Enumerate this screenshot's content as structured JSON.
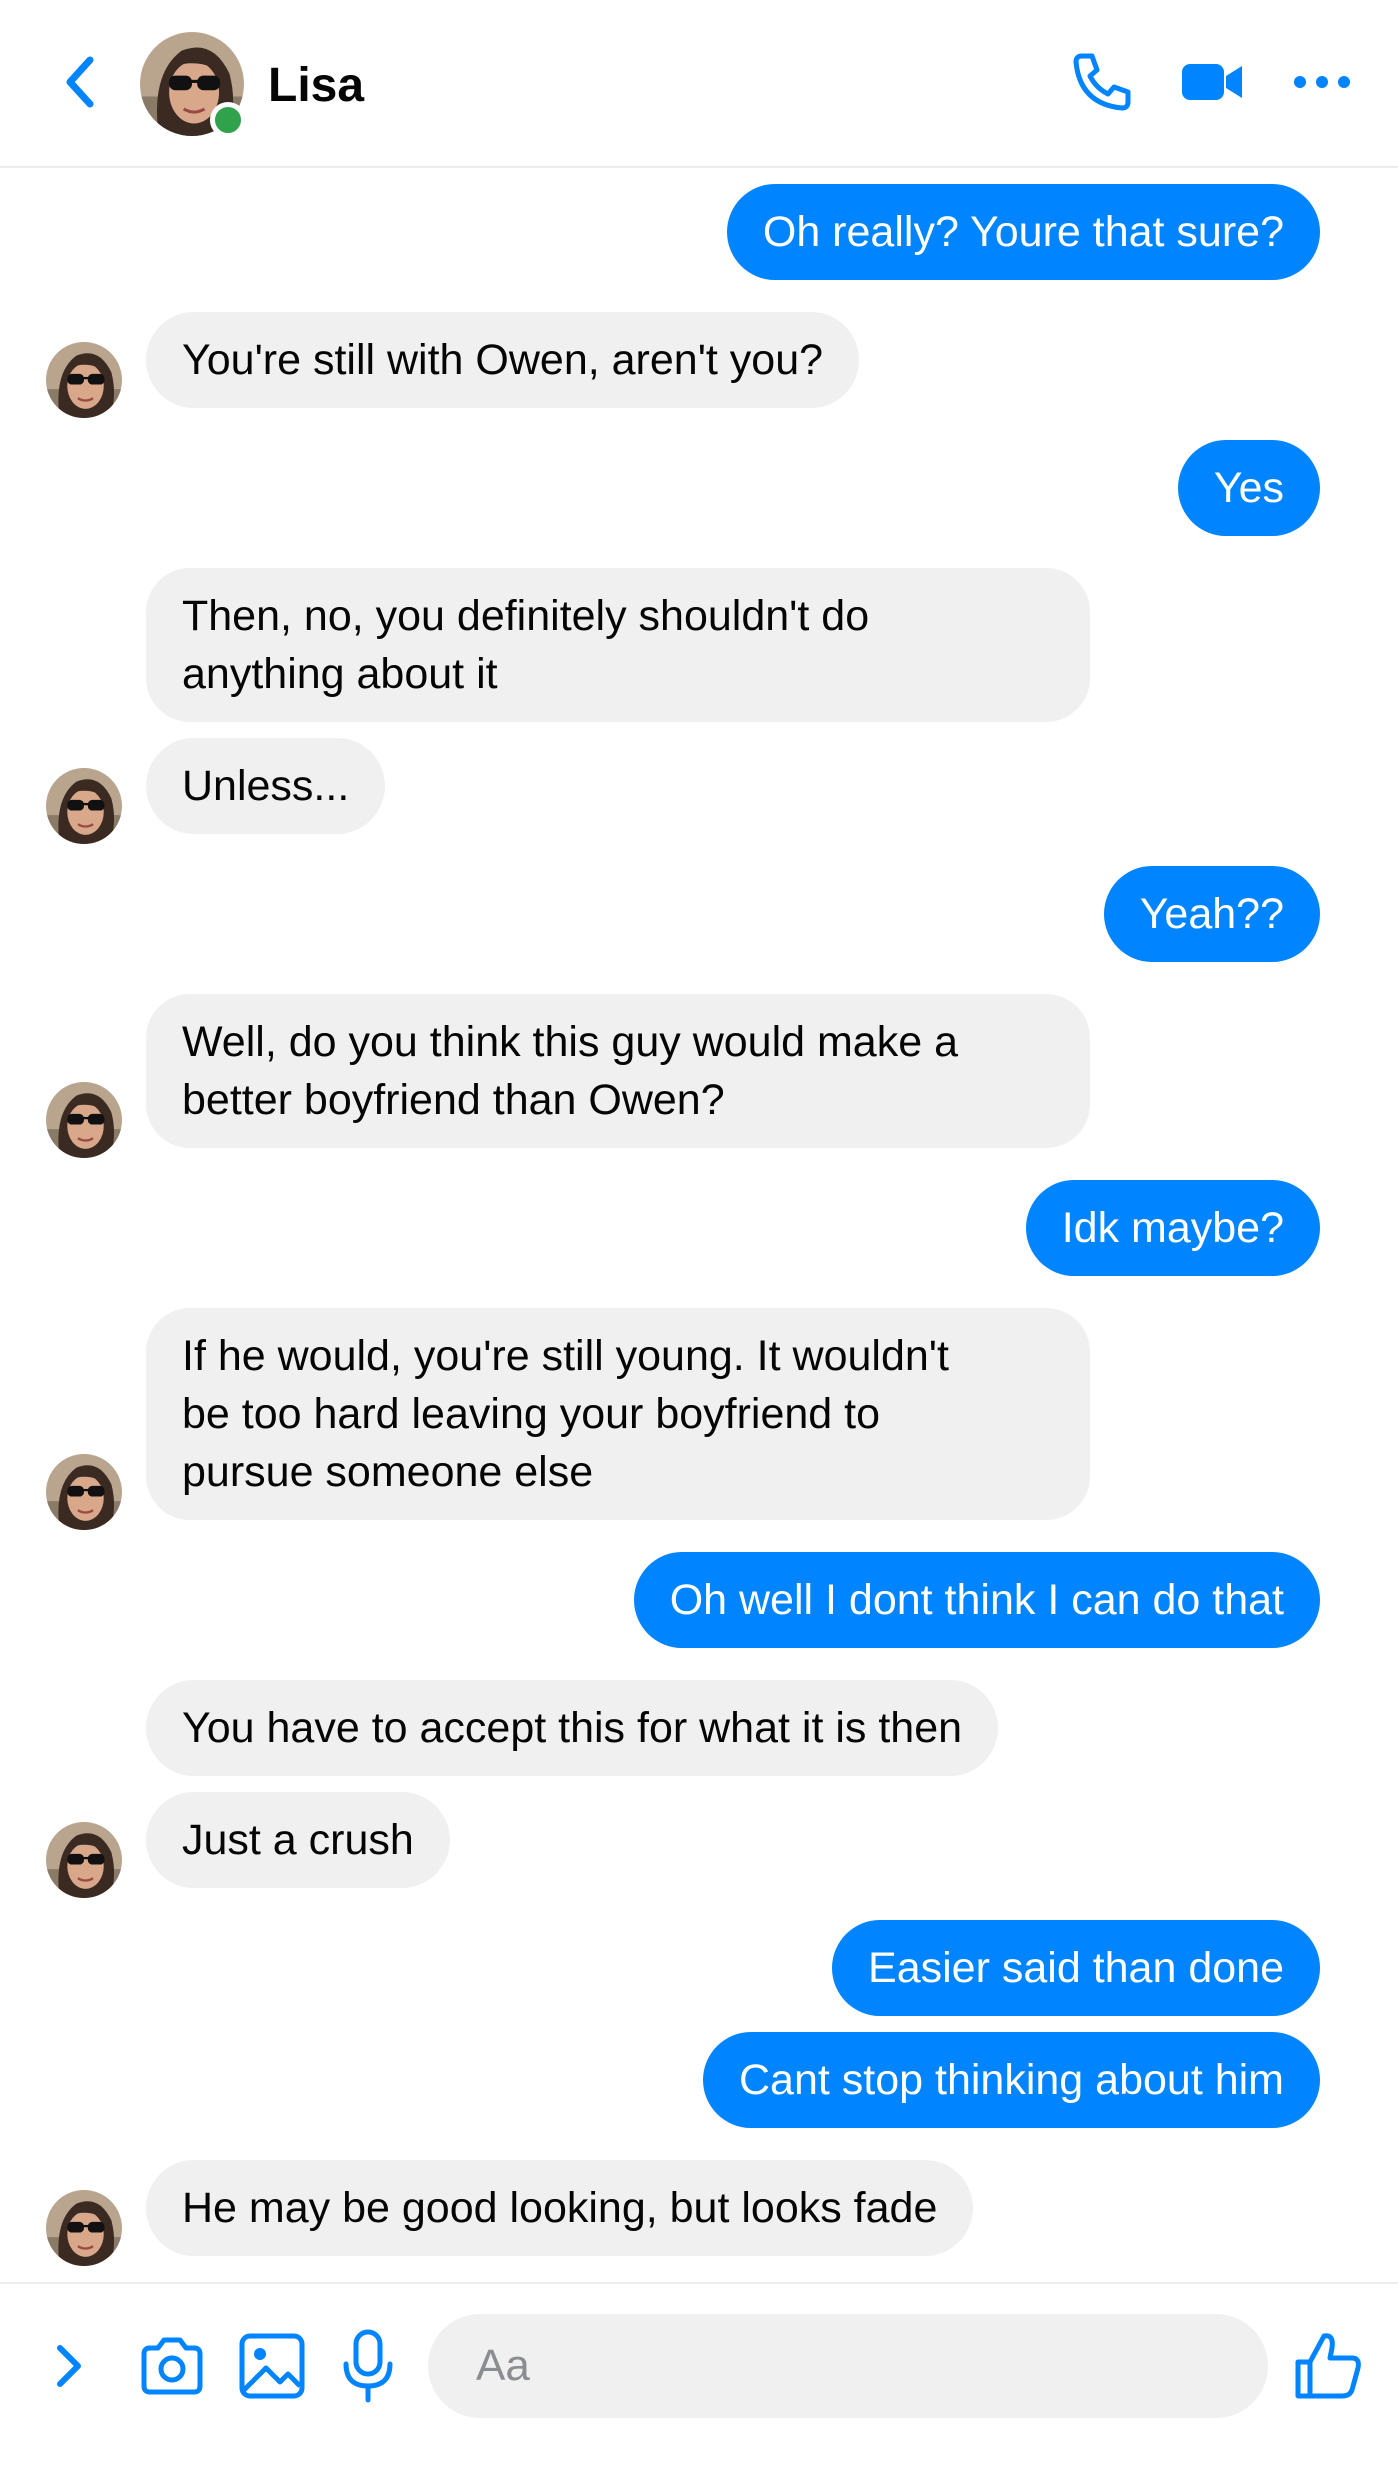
{
  "colors": {
    "accent": "#0084ff",
    "incoming_bubble": "#f0f0f0",
    "online": "#31a24c"
  },
  "header": {
    "contact_name": "Lisa",
    "icons": [
      "back-chevron-icon",
      "phone-icon",
      "video-camera-icon",
      "more-dots-icon"
    ]
  },
  "messages": [
    {
      "from": "me",
      "text": "Oh really? Youre that sure?"
    },
    {
      "from": "them",
      "text": "You're still with Owen, aren't you?"
    },
    {
      "from": "me",
      "text": "Yes"
    },
    {
      "from": "them",
      "lines": [
        "Then, no, you definitely shouldn't do",
        "anything about it"
      ]
    },
    {
      "from": "them",
      "text": "Unless..."
    },
    {
      "from": "me",
      "text": "Yeah??"
    },
    {
      "from": "them",
      "lines": [
        "Well, do you think this guy would make a",
        "better boyfriend than Owen?"
      ]
    },
    {
      "from": "me",
      "text": "Idk maybe?"
    },
    {
      "from": "them",
      "lines": [
        "If he would, you're still young. It wouldn't",
        "be too hard leaving your boyfriend to",
        "pursue someone else"
      ]
    },
    {
      "from": "me",
      "text": "Oh well I dont think I can do that"
    },
    {
      "from": "them",
      "text": "You have to accept this for what it is then"
    },
    {
      "from": "them",
      "text": "Just a crush"
    },
    {
      "from": "me",
      "text": "Easier said than done"
    },
    {
      "from": "me",
      "text": "Cant stop thinking about him"
    },
    {
      "from": "them",
      "text": "He may be good looking, but looks fade"
    }
  ],
  "composer": {
    "placeholder": "Aa",
    "icons": [
      "expand-chevron-icon",
      "camera-icon",
      "gallery-icon",
      "microphone-icon",
      "like-thumb-icon"
    ]
  }
}
